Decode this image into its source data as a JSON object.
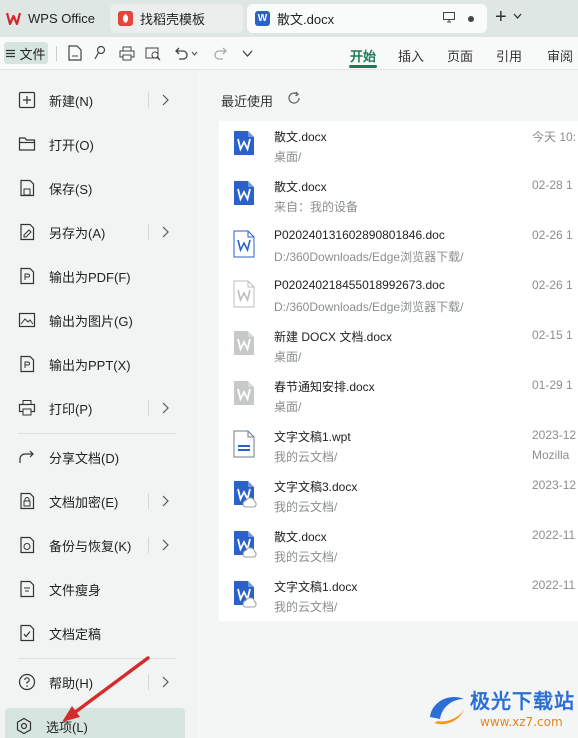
{
  "tabs": [
    {
      "label": "WPS Office",
      "icon": "wps-logo-icon"
    },
    {
      "label": "找稻壳模板",
      "icon": "docer-logo-icon"
    },
    {
      "label": "散文.docx",
      "icon": "word-doc-icon"
    }
  ],
  "toolbar": {
    "file_label": "文件",
    "ribbon_tabs": [
      "开始",
      "插入",
      "页面",
      "引用",
      "审阅"
    ],
    "active_tab": "开始"
  },
  "menu": {
    "items": [
      {
        "label": "新建(N)",
        "icon": "new-file-icon",
        "submenu": true
      },
      {
        "label": "打开(O)",
        "icon": "folder-open-icon",
        "submenu": false
      },
      {
        "label": "保存(S)",
        "icon": "save-icon",
        "submenu": false
      },
      {
        "label": "另存为(A)",
        "icon": "save-as-icon",
        "submenu": true
      },
      {
        "label": "输出为PDF(F)",
        "icon": "export-pdf-icon",
        "submenu": false
      },
      {
        "label": "输出为图片(G)",
        "icon": "export-image-icon",
        "submenu": false
      },
      {
        "label": "输出为PPT(X)",
        "icon": "export-ppt-icon",
        "submenu": false
      },
      {
        "label": "打印(P)",
        "icon": "print-icon",
        "submenu": true
      },
      {
        "label": "分享文档(D)",
        "icon": "share-icon",
        "submenu": false
      },
      {
        "label": "文档加密(E)",
        "icon": "encrypt-icon",
        "submenu": true
      },
      {
        "label": "备份与恢复(K)",
        "icon": "backup-icon",
        "submenu": true
      },
      {
        "label": "文件瘦身",
        "icon": "slim-file-icon",
        "submenu": false
      },
      {
        "label": "文档定稿",
        "icon": "finalize-icon",
        "submenu": false
      },
      {
        "label": "帮助(H)",
        "icon": "help-icon",
        "submenu": true
      },
      {
        "label": "选项(L)",
        "icon": "options-icon",
        "submenu": false
      }
    ]
  },
  "recent": {
    "title": "最近使用",
    "files": [
      {
        "name": "散文.docx",
        "location": "桌面/",
        "date": "今天 10:",
        "date2": "",
        "type": "word",
        "style": "blue"
      },
      {
        "name": "散文.docx",
        "location": "来自：我的设备",
        "date": "02-28 1",
        "date2": "",
        "type": "word",
        "style": "blue"
      },
      {
        "name": "P020240131602890801846.doc",
        "location": "D:/360Downloads/Edge浏览器下载/",
        "date": "02-26 1",
        "date2": "",
        "type": "word",
        "style": "outline-blue"
      },
      {
        "name": "P020240218455018992673.doc",
        "location": "D:/360Downloads/Edge浏览器下载/",
        "date": "02-26 1",
        "date2": "",
        "type": "word",
        "style": "outline-gray"
      },
      {
        "name": "新建 DOCX 文档.docx",
        "location": "桌面/",
        "date": "02-15 1",
        "date2": "",
        "type": "word",
        "style": "gray"
      },
      {
        "name": "春节通知安排.docx",
        "location": "桌面/",
        "date": "01-29 1",
        "date2": "",
        "type": "word",
        "style": "gray"
      },
      {
        "name": "文字文稿1.wpt",
        "location": "我的云文档/",
        "date": "2023-12",
        "date2": "Mozilla",
        "type": "template",
        "style": "blue"
      },
      {
        "name": "文字文稿3.docx",
        "location": "我的云文档/",
        "date": "2023-12",
        "date2": "",
        "type": "word",
        "style": "cloud"
      },
      {
        "name": "散文.docx",
        "location": "我的云文档/",
        "date": "2022-11",
        "date2": "",
        "type": "word",
        "style": "cloud"
      },
      {
        "name": "文字文稿1.docx",
        "location": "我的云文档/",
        "date": "2022-11",
        "date2": "",
        "type": "word",
        "style": "cloud"
      }
    ]
  },
  "watermark": {
    "text": "极光下载站",
    "url": "www.xz7.com"
  },
  "colors": {
    "accent": "#1f7a55",
    "word_blue": "#2a62c9",
    "arrow_red": "#d42b2b"
  }
}
